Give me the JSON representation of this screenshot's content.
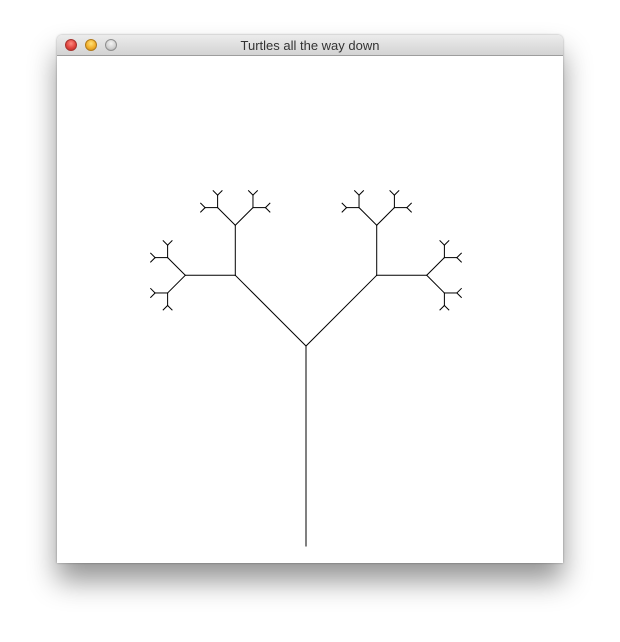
{
  "window": {
    "title": "Turtles all the way down",
    "controls": {
      "close_icon": "close-icon",
      "minimize_icon": "minimize-icon",
      "zoom_icon": "zoom-icon"
    }
  },
  "drawing": {
    "subject": "fractal binary tree drawn with turtle graphics",
    "stroke_color": "#000000",
    "background_color": "#ffffff",
    "recursion_depth": 5,
    "branch_angle_degrees": 45,
    "length_ratio": 0.5
  }
}
